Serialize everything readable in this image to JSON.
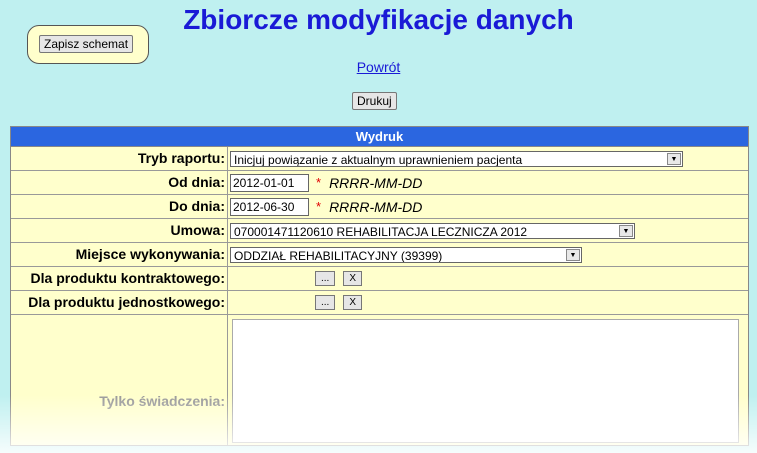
{
  "page": {
    "title": "Zbiorcze modyfikacje danych",
    "save_schema_label": "Zapisz schemat",
    "back_link": "Powrót",
    "print_label": "Drukuj"
  },
  "form": {
    "header": "Wydruk",
    "report_mode": {
      "label": "Tryb raportu:",
      "value": "Inicjuj powiązanie z aktualnym uprawnieniem pacjenta"
    },
    "date_from": {
      "label": "Od dnia:",
      "value": "2012-01-01",
      "required": "*",
      "format": "RRRR-MM-DD"
    },
    "date_to": {
      "label": "Do dnia:",
      "value": "2012-06-30",
      "required": "*",
      "format": "RRRR-MM-DD"
    },
    "contract": {
      "label": "Umowa:",
      "value": "070001471120610 REHABILITACJA LECZNICZA 2012"
    },
    "place": {
      "label": "Miejsce wykonywania:",
      "value": "ODDZIAŁ REHABILITACYJNY (39399)"
    },
    "contract_product": {
      "label": "Dla produktu kontraktowego:",
      "pick_label": "...",
      "clear_label": "X"
    },
    "unit_product": {
      "label": "Dla produktu jednostkowego:",
      "pick_label": "...",
      "clear_label": "X"
    },
    "services_only": {
      "label": "Tylko świadczenia:"
    }
  }
}
